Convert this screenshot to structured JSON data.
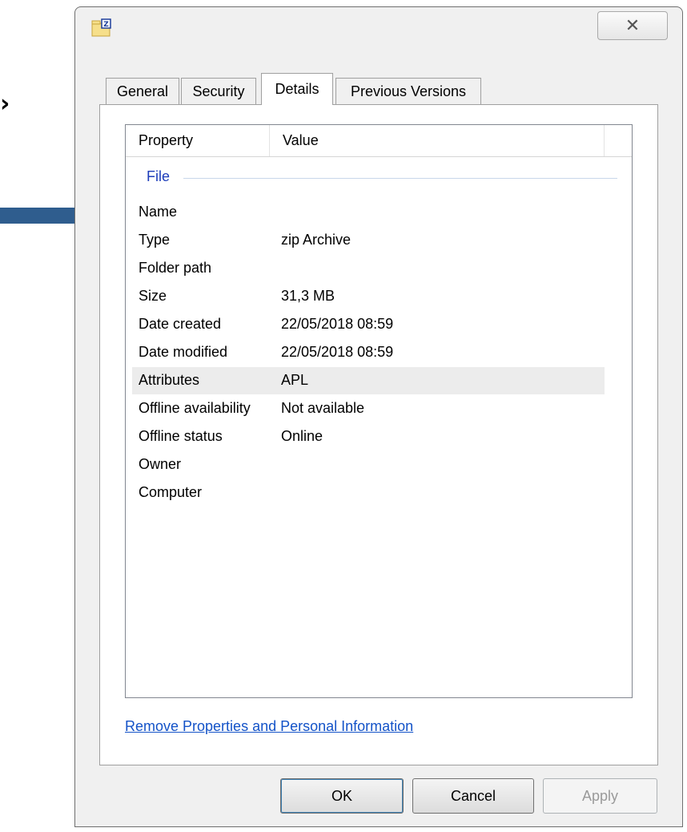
{
  "stray_glyph": "›",
  "window": {
    "close_glyph": "✕",
    "tabs": [
      {
        "label": "General"
      },
      {
        "label": "Security"
      },
      {
        "label": "Details"
      },
      {
        "label": "Previous Versions"
      }
    ],
    "active_tab": "Details"
  },
  "details": {
    "columns": {
      "property": "Property",
      "value": "Value"
    },
    "group": "File",
    "rows": [
      {
        "property": "Name",
        "value": ""
      },
      {
        "property": "Type",
        "value": "zip Archive"
      },
      {
        "property": "Folder path",
        "value": ""
      },
      {
        "property": "Size",
        "value": "31,3 MB"
      },
      {
        "property": "Date created",
        "value": "22/05/2018 08:59"
      },
      {
        "property": "Date modified",
        "value": "22/05/2018 08:59"
      },
      {
        "property": "Attributes",
        "value": "APL"
      },
      {
        "property": "Offline availability",
        "value": "Not available"
      },
      {
        "property": "Offline status",
        "value": "Online"
      },
      {
        "property": "Owner",
        "value": ""
      },
      {
        "property": "Computer",
        "value": ""
      }
    ],
    "selected_row": "Attributes",
    "remove_link": "Remove Properties and Personal Information"
  },
  "buttons": {
    "ok": "OK",
    "cancel": "Cancel",
    "apply": "Apply"
  },
  "colors": {
    "arrow": "#2f5d8e",
    "link": "#1453c8",
    "group_label": "#1e3dba"
  }
}
